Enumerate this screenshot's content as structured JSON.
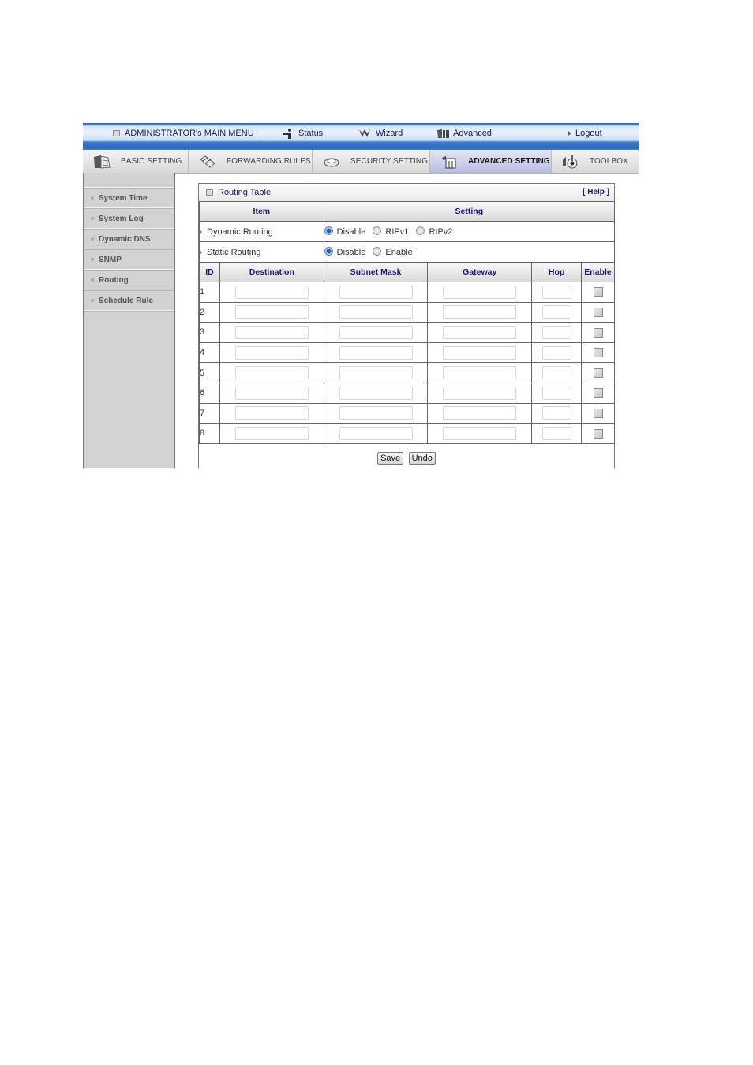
{
  "top_menu": {
    "title": "ADMINISTRATOR's MAIN MENU",
    "items": [
      {
        "label": "Status",
        "icon": "status-person-icon"
      },
      {
        "label": "Wizard",
        "icon": "wizard-icon"
      },
      {
        "label": "Advanced",
        "icon": "advanced-icon"
      },
      {
        "label": "Logout",
        "icon": "logout-arrow-icon"
      }
    ]
  },
  "tabs": [
    {
      "label": "BASIC SETTING",
      "icon": "basic-setting-icon",
      "active": false
    },
    {
      "label": "FORWARDING RULES",
      "icon": "forwarding-rules-icon",
      "active": false
    },
    {
      "label": "SECURITY SETTING",
      "icon": "security-setting-icon",
      "active": false
    },
    {
      "label": "ADVANCED SETTING",
      "icon": "advanced-setting-icon",
      "active": true
    },
    {
      "label": "TOOLBOX",
      "icon": "toolbox-icon",
      "active": false
    }
  ],
  "sidebar": {
    "items": [
      {
        "label": "System Time"
      },
      {
        "label": "System Log"
      },
      {
        "label": "Dynamic DNS"
      },
      {
        "label": "SNMP"
      },
      {
        "label": "Routing"
      },
      {
        "label": "Schedule Rule"
      }
    ]
  },
  "panel": {
    "title": "Routing Table",
    "help": "[ Help ]",
    "header": {
      "item": "Item",
      "setting": "Setting"
    },
    "dynamic_routing": {
      "label": "Dynamic Routing",
      "options": [
        "Disable",
        "RIPv1",
        "RIPv2"
      ],
      "selected": "Disable"
    },
    "static_routing": {
      "label": "Static Routing",
      "options": [
        "Disable",
        "Enable"
      ],
      "selected": "Disable"
    },
    "columns": [
      "ID",
      "Destination",
      "Subnet Mask",
      "Gateway",
      "Hop",
      "Enable"
    ],
    "rows": [
      {
        "id": "1",
        "destination": "",
        "subnet_mask": "",
        "gateway": "",
        "hop": "",
        "enabled": false
      },
      {
        "id": "2",
        "destination": "",
        "subnet_mask": "",
        "gateway": "",
        "hop": "",
        "enabled": false
      },
      {
        "id": "3",
        "destination": "",
        "subnet_mask": "",
        "gateway": "",
        "hop": "",
        "enabled": false
      },
      {
        "id": "4",
        "destination": "",
        "subnet_mask": "",
        "gateway": "",
        "hop": "",
        "enabled": false
      },
      {
        "id": "5",
        "destination": "",
        "subnet_mask": "",
        "gateway": "",
        "hop": "",
        "enabled": false
      },
      {
        "id": "6",
        "destination": "",
        "subnet_mask": "",
        "gateway": "",
        "hop": "",
        "enabled": false
      },
      {
        "id": "7",
        "destination": "",
        "subnet_mask": "",
        "gateway": "",
        "hop": "",
        "enabled": false
      },
      {
        "id": "8",
        "destination": "",
        "subnet_mask": "",
        "gateway": "",
        "hop": "",
        "enabled": false
      }
    ],
    "buttons": {
      "save": "Save",
      "undo": "Undo"
    }
  },
  "colors": {
    "accent_blue": "#2f6cc2",
    "title_text": "#1a1a70",
    "sidebar_bg": "#d2d2d2",
    "active_tab": "#b8bde0"
  }
}
